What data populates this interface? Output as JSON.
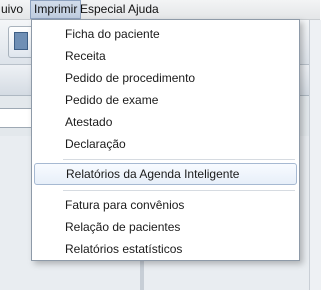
{
  "menubar": {
    "items": [
      {
        "label": "uivo"
      },
      {
        "label": "Imprimir"
      },
      {
        "label": "Especial"
      },
      {
        "label": "Ajuda"
      }
    ]
  },
  "imprimir_menu": {
    "group1": [
      {
        "label": "Ficha do paciente"
      },
      {
        "label": "Receita"
      },
      {
        "label": "Pedido de procedimento"
      },
      {
        "label": "Pedido de exame"
      },
      {
        "label": "Atestado"
      },
      {
        "label": "Declaração"
      }
    ],
    "group2": [
      {
        "label": "Relatórios da Agenda Inteligente"
      }
    ],
    "group3": [
      {
        "label": "Fatura para convênios"
      },
      {
        "label": "Relação de pacientes"
      },
      {
        "label": "Relatórios estatísticos"
      }
    ]
  }
}
